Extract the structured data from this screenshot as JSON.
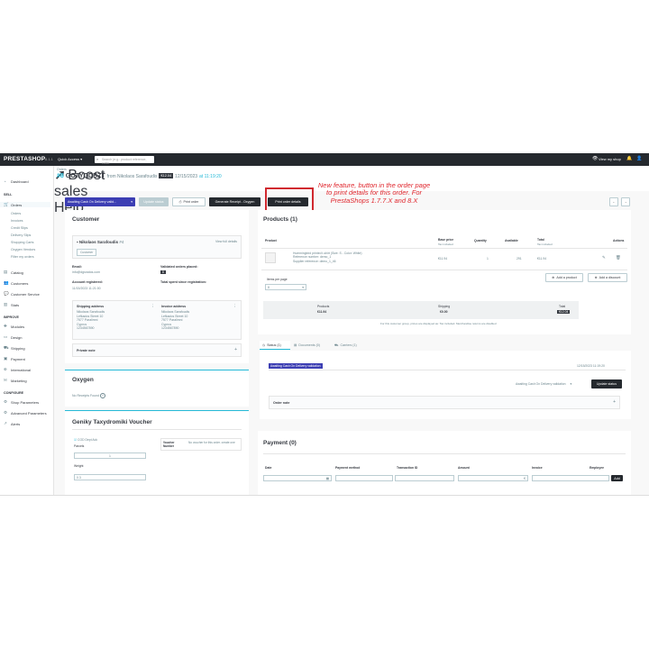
{
  "topbar": {
    "logo": "PRESTASHOP",
    "version": "8.1.1",
    "quick_access": "Quick Access ▾",
    "search_placeholder": "Search (e.g.: product reference, custo",
    "view_shop": "View my shop"
  },
  "sidebar": {
    "dashboard": "Dashboard",
    "sell_heading": "SELL",
    "orders": "Orders",
    "orders_sub": [
      "Orders",
      "Invoices",
      "Credit Slips",
      "Delivery Slips",
      "Shopping Carts",
      "Oxygen Vendors",
      "Filter my orders"
    ],
    "catalog": "Catalog",
    "customers": "Customers",
    "customer_service": "Customer Service",
    "stats": "Stats",
    "improve_heading": "IMPROVE",
    "modules": "Modules",
    "design": "Design",
    "shipping": "Shipping",
    "payment": "Payment",
    "international": "International",
    "marketing": "Marketing",
    "configure_heading": "CONFIGURE",
    "shop_parameters": "Shop Parameters",
    "advanced_parameters": "Advanced Parameters",
    "alerts": "Alerts"
  },
  "header": {
    "breadcrumb": "Orders",
    "order_number": "#8",
    "order_ref": "GOTYQDBZT",
    "from": "from Nikolaos Sarafoudis",
    "total": "€12.04",
    "date": "12/15/2023",
    "time": "at 11:19:20",
    "boost_sales": "Boost sales",
    "help": "Help"
  },
  "actions": {
    "status_select": "Awaiting Cash On Delivery valid...",
    "update_status": "Update status",
    "print_order": "Print order",
    "generate_receipt": "Generate Receipt - Oxygen",
    "print_order_details": "Print order details"
  },
  "annotation": {
    "text": "New feature, button in the order page to print details for this order. For PrestaShops 1.7.7.X and 8.X"
  },
  "customer": {
    "title": "Customer",
    "name": "Nikolaos Sarafoudis",
    "id": "#4",
    "view_full": "View full details",
    "badge": "Customer",
    "email_label": "Email:",
    "email": "info@dgsnatos.com",
    "validated_label": "Validated orders placed:",
    "validated_count": "8",
    "registered_label": "Account registered:",
    "registered": "11/15/2023 11:21:00",
    "spent_label": "Total spent since registration:",
    "shipping_label": "Shipping address",
    "shipping_lines": [
      "Nikolaos Sarafoudis",
      "Lefkados Street 10",
      "7577 Paralimni",
      "Cyprus",
      "1234567890"
    ],
    "invoice_label": "Invoice address",
    "invoice_lines": [
      "Nikolaos Sarafoudis",
      "Lefkados Street 10",
      "7577 Paralimni",
      "Cyprus",
      "1234567890"
    ],
    "private_note": "Private note"
  },
  "oxygen": {
    "title": "Oxygen",
    "no_receipts": "No Receipts Found"
  },
  "voucher": {
    "title": "Geniky Taxydromiki Voucher",
    "options": "COD  Dept  Ack",
    "parcels_label": "Parcels",
    "parcels": "1",
    "weight_label": "Weight",
    "weight": "0.3",
    "voucher_number_label": "Voucher Number",
    "voucher_none": "No voucher for this order. create one"
  },
  "products": {
    "title": "Products (1)",
    "headers": [
      "Product",
      "Base price",
      "Quantity",
      "Available",
      "Total",
      "Actions"
    ],
    "base_price_sub": "Tax included",
    "total_sub": "Tax included",
    "rows": [
      {
        "name": "Hummingbird printed t-shirt (Size: S - Color: White)",
        "ref": "Reference number: demo_1",
        "supplier": "Supplier reference: demo_1_46",
        "base_price": "€11.94",
        "quantity": "1",
        "available": "291",
        "total": "€11.94"
      }
    ],
    "add_product": "Add a product",
    "add_discount": "Add a discount",
    "items_per_page_label": "Items per page",
    "items_per_page": "8",
    "summary_products_label": "Products",
    "summary_products": "€11.94",
    "summary_shipping_label": "Shipping",
    "summary_shipping": "€0.00",
    "summary_total_label": "Total",
    "summary_total": "€12.04",
    "summary_note": "For this customer group, prices are displayed as: Tax included. Merchandise returns are disabled"
  },
  "tabs": {
    "status": "Status (1)",
    "documents": "Documents (0)",
    "carriers": "Carriers (1)"
  },
  "status": {
    "badge": "Awaiting Cash On Delivery validation",
    "date": "12/15/2023 11:19:20",
    "select": "Awaiting Cash On Delivery validation",
    "update": "Update status",
    "order_note": "Order note"
  },
  "payment": {
    "title": "Payment (0)",
    "headers": [
      "Date",
      "Payment method",
      "Transaction ID",
      "Amount",
      "Invoice",
      "Employee"
    ],
    "currency": "€",
    "add": "Add"
  }
}
